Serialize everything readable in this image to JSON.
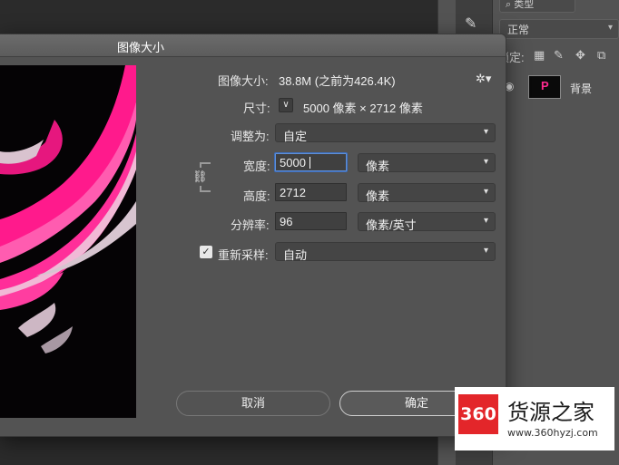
{
  "layers_panel": {
    "filter_label": "⌕ 类型",
    "blend_mode": "正常",
    "lock_label": "锁定:",
    "layer_name": "背景",
    "layer_thumb_letter": "P"
  },
  "dialog": {
    "title": "图像大小",
    "image_size_label": "图像大小:",
    "image_size_value": "38.8M (之前为426.4K)",
    "dimensions_label": "尺寸:",
    "dimensions_value": "5000 像素  ×  2712 像素",
    "fit_to_label": "调整为:",
    "fit_to_value": "自定",
    "width_label": "宽度:",
    "width_value": "5000",
    "width_unit": "像素",
    "height_label": "高度:",
    "height_value": "2712",
    "height_unit": "像素",
    "resolution_label": "分辨率:",
    "resolution_value": "96",
    "resolution_unit": "像素/英寸",
    "resample_label": "重新采样:",
    "resample_value": "自动",
    "resample_checked": true,
    "cancel_label": "取消",
    "ok_label": "确定"
  },
  "watermark": {
    "logo_text": "360",
    "title": "货源之家",
    "url": "www.360hyzj.com"
  },
  "colors": {
    "dialog_bg": "#535353",
    "field_bg": "#404040",
    "focus_ring": "#3d6fbf",
    "accent_pink": "#ff2a8f",
    "watermark_red": "#e3262a"
  }
}
